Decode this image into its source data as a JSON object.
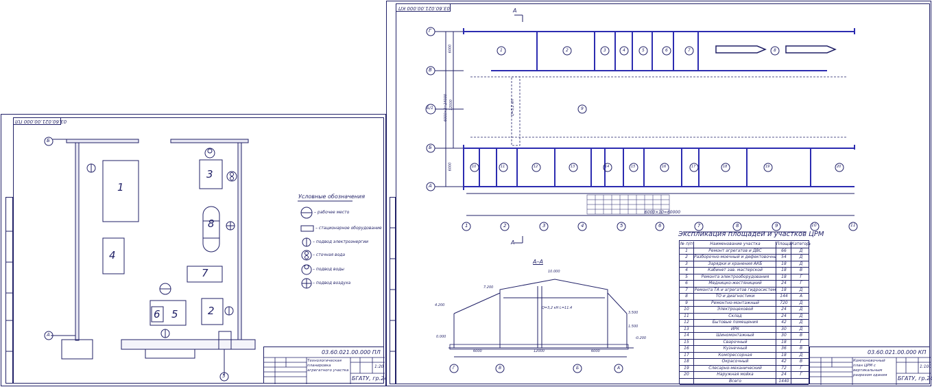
{
  "left_sheet": {
    "doc_code_top": "03.60.021.00.000 ПЛ",
    "doc_code": "03.60.021.00.000 ПЛ",
    "title": "Технологическая планировка агрегатного участка",
    "scale": "1:20",
    "org": "БГАТУ, гр.24 тс",
    "axis_labels": [
      "Б",
      "А",
      "5"
    ],
    "items": [
      "1",
      "2",
      "3",
      "4",
      "5",
      "6",
      "7",
      "8"
    ],
    "legend": {
      "title": "Условные обозначения",
      "entries": [
        "– рабочее место",
        "– стационарное оборудование",
        "– подвод электроэнергии",
        "– сточная вода",
        "– подвод воды",
        "– подвод воздуха"
      ]
    }
  },
  "right_sheet": {
    "doc_code_top": "03.60.021.00.000 КП",
    "doc_code": "03.60.021.00.000 КП",
    "title": "Компоновочный план ЦРМ с вертикальным разрезом здания",
    "scale": "1:100",
    "org": "БГАТУ, гр.24 тс",
    "section_marker": "А",
    "section_title": "А–А",
    "row_axes": [
      "Г",
      "В",
      "Б/1",
      "Б",
      "А"
    ],
    "col_axes": [
      "1",
      "2",
      "3",
      "4",
      "5",
      "6",
      "7",
      "8",
      "9",
      "10",
      "11"
    ],
    "dims": {
      "span_total": "6000×10=60000",
      "left_v1": "6000",
      "left_v2": "12000",
      "left_v3": "6000×2=24000",
      "left_v4": "6000",
      "crane": "Q=3,2 кН",
      "sec_6000_l": "6000",
      "sec_12000": "12000",
      "sec_6000_r": "6000",
      "lvl_10000": "10.000",
      "lvl_7200": "7.200",
      "lvl_4200": "4.200",
      "lvl_3500": "3.500",
      "lvl_0": "0.000",
      "lvl_1500": "1.500",
      "lvl_m200": "-0.200",
      "beam": "Q=3,2 кН L=11.4"
    },
    "sec_axes": [
      "Г",
      "В",
      "Б",
      "А"
    ],
    "rooms_top": [
      "1",
      "2",
      "3",
      "4",
      "5",
      "6",
      "7",
      "8"
    ],
    "room_mid": "9",
    "rooms_bottom": [
      "10",
      "11",
      "12",
      "13",
      "14",
      "15",
      "16",
      "17",
      "18",
      "19",
      "20"
    ],
    "explication": {
      "title": "Экспликация площадей и участков ЦРМ",
      "headers": [
        "№ п/п",
        "Наименование участка",
        "Площадь",
        "Категория"
      ],
      "rows": [
        [
          "1",
          "Ремонт агрегатов и ДВС",
          "66",
          "Д"
        ],
        [
          "2",
          "Разборочно-моечный и дефектовочный",
          "54",
          "Д"
        ],
        [
          "3",
          "Зарядки и хранения АКБ",
          "18",
          "Д"
        ],
        [
          "4",
          "Кабинет зав. мастерской",
          "18",
          "В"
        ],
        [
          "5",
          "Ремонта электрооборудования",
          "18",
          "Г"
        ],
        [
          "6",
          "Медницко-жестяницкий",
          "24",
          "Г"
        ],
        [
          "7",
          "Ремонта ТА и агрегатов гидросистем",
          "18",
          "Д"
        ],
        [
          "8",
          "ТО и диагностики",
          "144",
          "А"
        ],
        [
          "9",
          "Ремонтно-монтажный",
          "720",
          "Д"
        ],
        [
          "10",
          "Электроцеховой",
          "24",
          "Д"
        ],
        [
          "11",
          "Склад",
          "24",
          "Д"
        ],
        [
          "12",
          "Бытовые помещения",
          "42",
          "Д"
        ],
        [
          "13",
          "ИРК",
          "30",
          "Д"
        ],
        [
          "14",
          "Шиномонтажный",
          "30",
          "В"
        ],
        [
          "15",
          "Сварочный",
          "18",
          "Г"
        ],
        [
          "16",
          "Кузнечный",
          "36",
          "В"
        ],
        [
          "17",
          "Компрессорная",
          "18",
          "Д"
        ],
        [
          "18",
          "Окрасочный",
          "42",
          "В"
        ],
        [
          "19",
          "Слесарно-механический",
          "72",
          "Г"
        ],
        [
          "20",
          "Наружная мойка",
          "24",
          "Г"
        ],
        [
          "",
          "Всего",
          "1440",
          ""
        ]
      ]
    }
  },
  "colors": {
    "line": "#1f1f66",
    "wall": "#2b2bb0",
    "paper": "#ffffff"
  }
}
